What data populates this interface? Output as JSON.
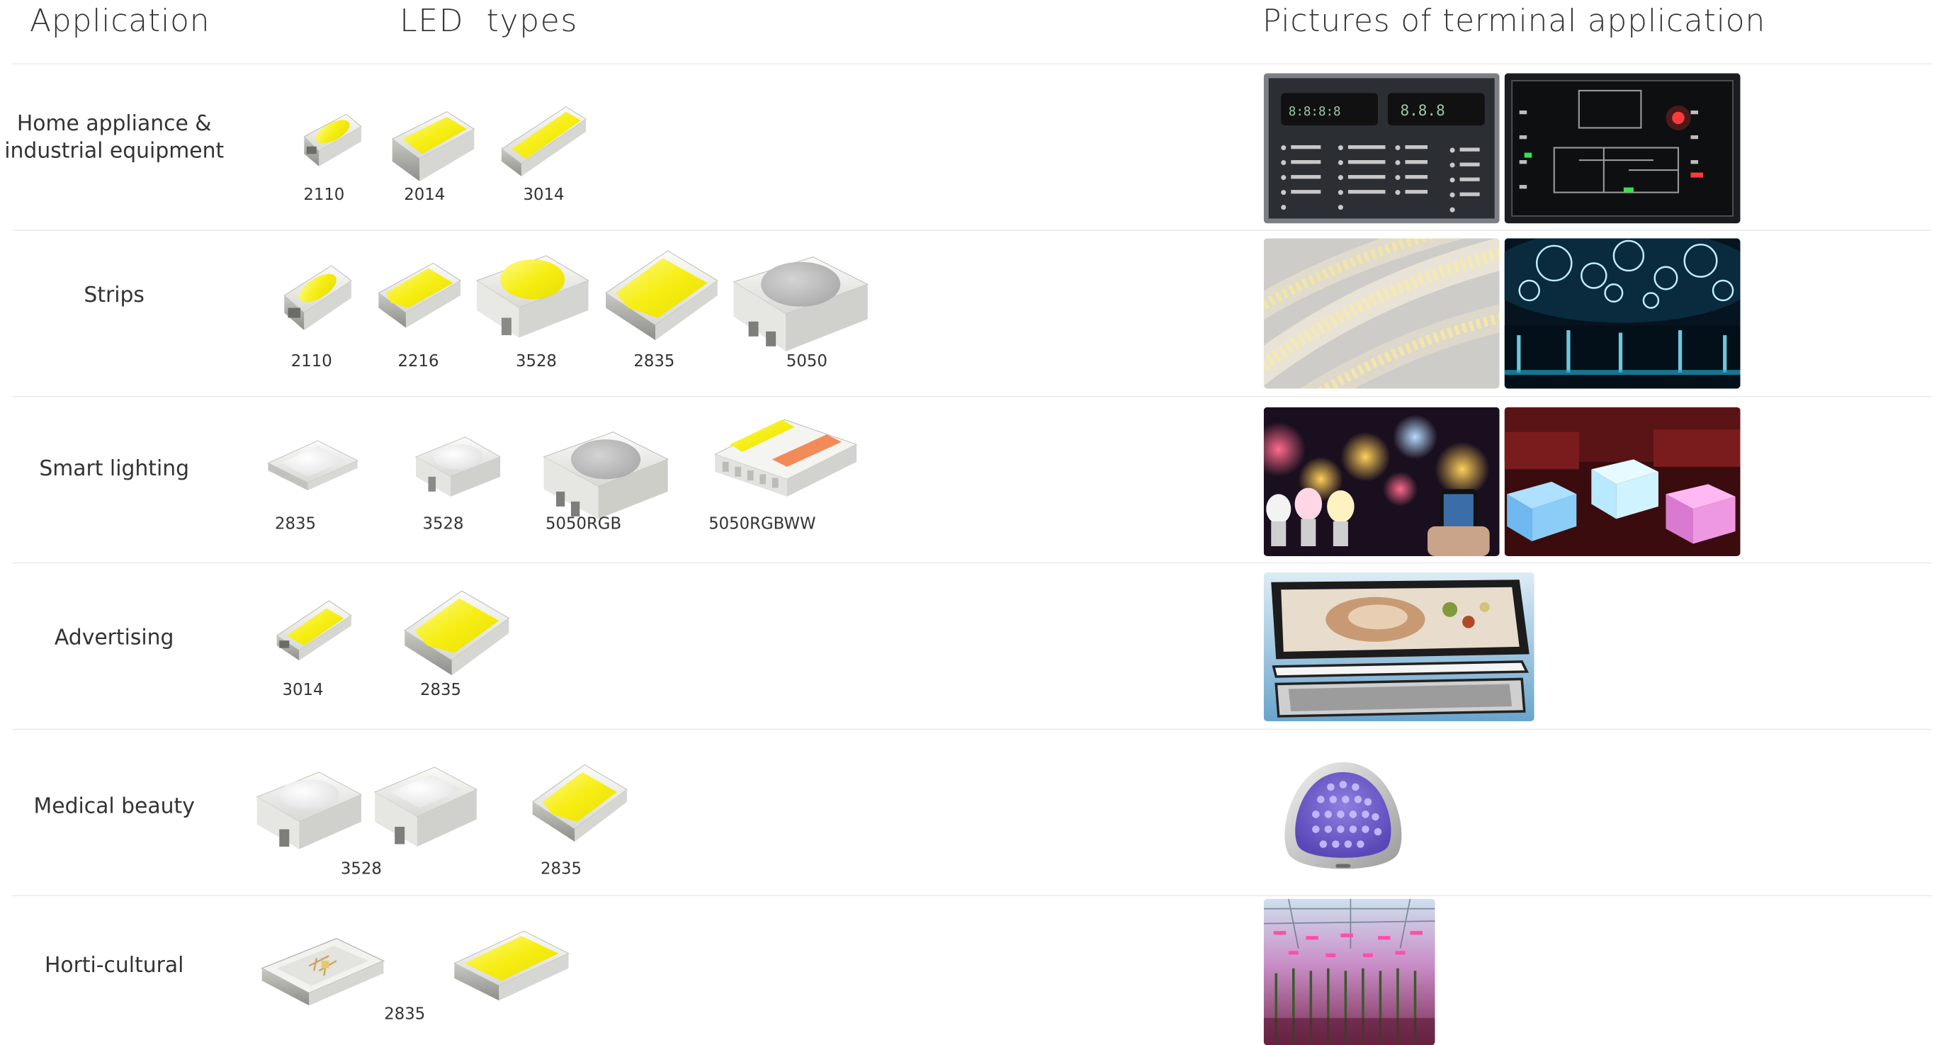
{
  "headers": {
    "application": "Application",
    "led_types": "LED  types",
    "pictures": "Pictures of terminal application"
  },
  "rows": [
    {
      "application": "Home appliance & industrial equipment",
      "application_lines": [
        "Home appliance &",
        "industrial equipment"
      ],
      "codes": [
        "2110",
        "2014",
        "3014"
      ],
      "pictures": [
        "appliance-control-panel",
        "appliance-display-panel"
      ]
    },
    {
      "application": "Strips",
      "codes": [
        "2110",
        "2216",
        "3528",
        "2835",
        "5050"
      ],
      "pictures": [
        "led-strip-reel",
        "lit-ceiling-venue"
      ]
    },
    {
      "application": "Smart lighting",
      "codes": [
        "2835",
        "3528",
        "5050RGB",
        "5050RGBWW"
      ],
      "pictures": [
        "smart-bulbs-phone",
        "glowing-cube-seats"
      ]
    },
    {
      "application": "Advertising",
      "codes": [
        "3014",
        "2835"
      ],
      "pictures": [
        "light-box-panel"
      ]
    },
    {
      "application": "Medical beauty",
      "codes": [
        "3528",
        "2835"
      ],
      "pictures": [
        "uv-beauty-device"
      ]
    },
    {
      "application": "Horti-cultural",
      "codes": [
        "2835"
      ],
      "pictures": [
        "greenhouse-grow-lights"
      ]
    }
  ],
  "colors": {
    "led_yellow": "#f7ef1c",
    "led_body": "#f1f1ee",
    "led_grey_lens": "#b8b8b8",
    "rgbww_orange": "#f28a5a"
  }
}
